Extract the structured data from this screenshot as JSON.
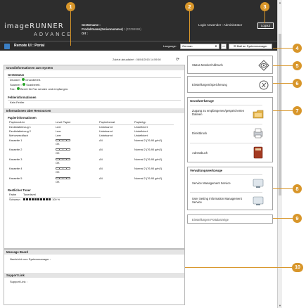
{
  "header": {
    "brand_line1": "imageRUNNER",
    "brand_line2": "ADVANCE",
    "device_name_label": "Gerätename :",
    "device_name_value": "",
    "product_label": "Produktname(Seriennummer) :",
    "product_value": "(ZZZ99999)",
    "location_label": "Ort :",
    "location_value": "",
    "login_user_label": "Login Anwender :",
    "login_user_value": "Administrator",
    "logout_label": "Logout"
  },
  "titlebar": {
    "title": "Remote UI : Portal",
    "language_label": "Language:",
    "language_value": "German",
    "mail_button": "Mail an Systemmanager"
  },
  "status": {
    "last_updated": "Zuletzt aktualisiert : 08/04/2015 14:59:50",
    "system_section": "Grundinformationen zum System",
    "device_status_title": "Gerätstatus",
    "devices": [
      {
        "name": "Drucker :",
        "status": "Druckbereit."
      },
      {
        "name": "Scanner :",
        "status": "Scanbereit."
      },
      {
        "name": "Fax :",
        "status": "Bereit für Fax senden und empfangen."
      }
    ],
    "error_title": "Fehlerinformationen",
    "error_text": "Kein Fehler",
    "consumables_section": "Informationen über Ressourcen",
    "paper_title": "Papierinformationen",
    "paper_headers": [
      "Papierzufuhr",
      "Level Papier",
      "Papierformat",
      "Papiertyp"
    ],
    "paper_rows": [
      {
        "source": "Deckblatteinzug 1",
        "level": "Leer",
        "ok": "",
        "size": "Unbekannt",
        "type": "Undefiniert"
      },
      {
        "source": "Deckblatteinzug 2",
        "level": "Leer",
        "ok": "",
        "size": "Unbekannt",
        "type": "Undefiniert"
      },
      {
        "source": "Mehrzweckfach",
        "level": "Leer",
        "ok": "",
        "size": "Unbekannt",
        "type": "Undefiniert"
      },
      {
        "source": "Kassette 1",
        "level": "",
        "ok": "OK",
        "size": "A4",
        "type": "Normal 2 (76-90 g/m2)"
      },
      {
        "source": "Kassette 2",
        "level": "",
        "ok": "OK",
        "size": "A4",
        "type": "Normal 2 (76-90 g/m2)"
      },
      {
        "source": "Kassette 3",
        "level": "",
        "ok": "OK",
        "size": "A4",
        "type": "Normal 2 (76-90 g/m2)"
      },
      {
        "source": "Kassette 4",
        "level": "",
        "ok": "OK",
        "size": "A4",
        "type": "Normal 2 (76-90 g/m2)"
      },
      {
        "source": "Kassette 5",
        "level": "",
        "ok": "OK",
        "size": "A4",
        "type": "Normal 2 (76-90 g/m2)"
      }
    ],
    "toner_title": "Restlicher Toner",
    "toner_headers": [
      "Farbe",
      "Tonerlevel"
    ],
    "toner_color": "Schwarz :",
    "toner_level": "100 %",
    "toner_fraction": 1.0,
    "message_board_title": "Message Board",
    "message_text": "Nachricht vom Systemmanager :",
    "support_title": "Support Link",
    "support_text": "Support Link :"
  },
  "right": {
    "status_monitor": "Status Monitor/Abbruch",
    "settings": "Einstellungen/Speicherung",
    "basic_tools_title": "Grundwerkzeuge",
    "basic_tools": [
      "Zugang zu empfangenen/gespeicherten Dateien",
      "Direktdruck",
      "Adressbuch"
    ],
    "mgmt_tools_title": "Verwaltungswerkzeuge",
    "mgmt_tools": [
      "Service Management Service",
      "User Setting Information Management Service"
    ],
    "portal_settings": "Einstellungen Portalanzeige"
  },
  "callouts": [
    "1",
    "2",
    "3",
    "4",
    "5",
    "6",
    "7",
    "8",
    "9",
    "10"
  ],
  "colors": {
    "callout": "#d8962a",
    "header": "#2d2d2d",
    "ok_dot": "#29a329"
  }
}
